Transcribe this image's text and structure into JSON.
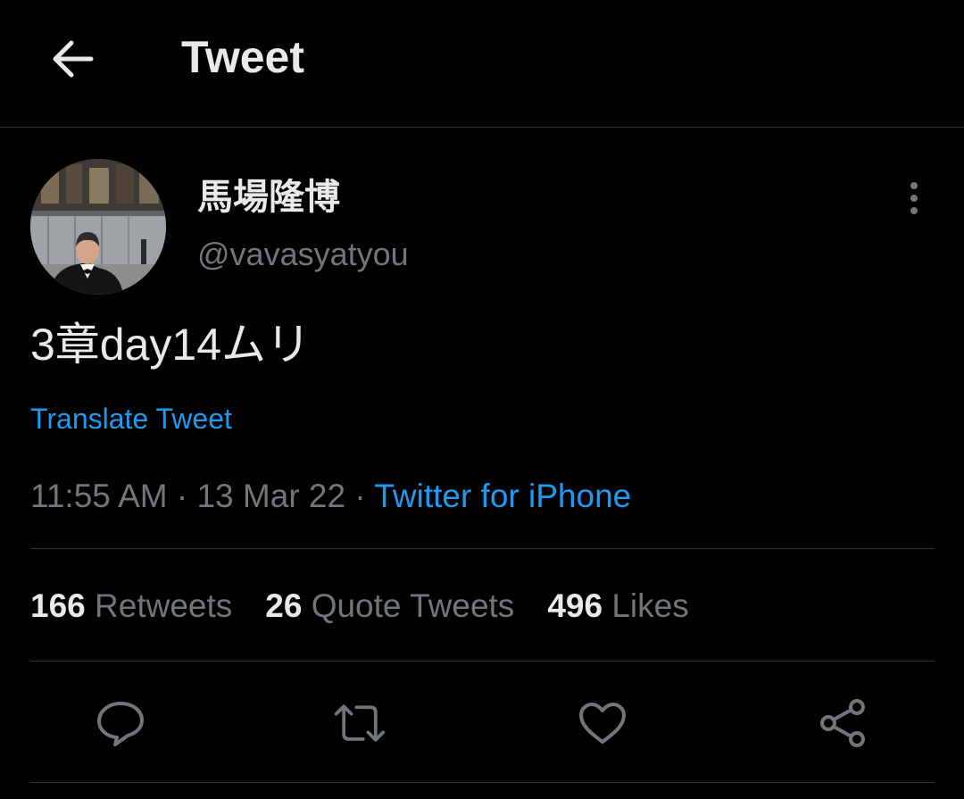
{
  "header": {
    "title": "Tweet",
    "back_icon": "arrow-left-icon"
  },
  "author": {
    "display_name": "馬場隆博",
    "handle": "@vavasyatyou"
  },
  "tweet": {
    "text": "3章day14ムリ",
    "translate_label": "Translate Tweet",
    "time": "11:55 AM",
    "separator": "·",
    "date": "13 Mar 22",
    "source": "Twitter for iPhone"
  },
  "stats": {
    "retweets_count": "166",
    "retweets_label": "Retweets",
    "quotes_count": "26",
    "quotes_label": "Quote Tweets",
    "likes_count": "496",
    "likes_label": "Likes"
  },
  "actions": [
    "reply-icon",
    "retweet-icon",
    "like-icon",
    "share-icon"
  ],
  "colors": {
    "background": "#000000",
    "text_primary": "#e7e9ea",
    "text_secondary": "#71767b",
    "accent": "#1d9bf0",
    "divider": "#2f3336"
  }
}
